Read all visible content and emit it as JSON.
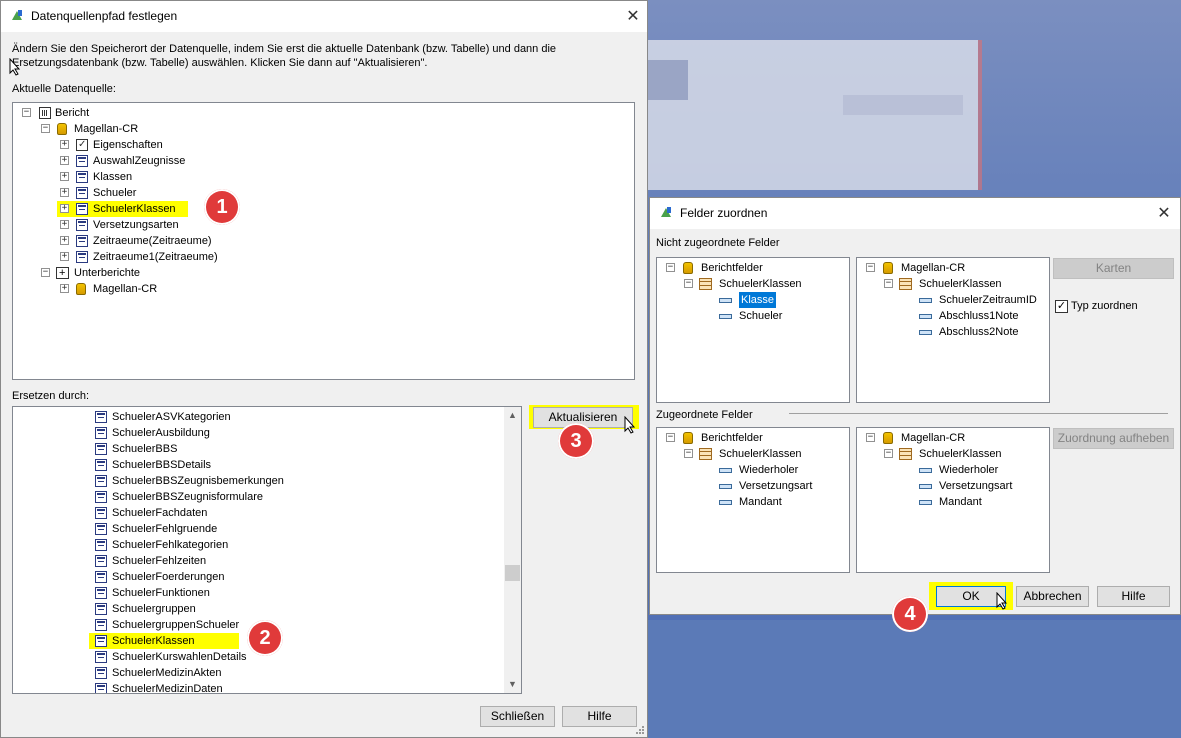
{
  "main_dialog": {
    "title": "Datenquellenpfad festlegen",
    "instruction_line1": "Ändern Sie den Speicherort der Datenquelle, indem Sie erst die aktuelle Datenbank (bzw. Tabelle) und dann die",
    "instruction_line2": "Ersetzungsdatenbank (bzw. Tabelle) auswählen. Klicken Sie dann auf \"Aktualisieren\".",
    "current_label": "Aktuelle Datenquelle:",
    "replace_label": "Ersetzen durch:",
    "update_button": "Aktualisieren",
    "close_button": "Schließen",
    "help_button": "Hilfe",
    "current_tree": {
      "root": "Bericht",
      "db": "Magellan-CR",
      "tables": [
        "Eigenschaften",
        "AuswahlZeugnisse",
        "Klassen",
        "Schueler",
        "SchuelerKlassen",
        "Versetzungsarten",
        "Zeitraeume(Zeitraeume)",
        "Zeitraeume1(Zeitraeume)"
      ],
      "subreports": "Unterberichte",
      "sub_db": "Magellan-CR"
    },
    "replace_list": [
      "SchuelerASVKategorien",
      "SchuelerAusbildung",
      "SchuelerBBS",
      "SchuelerBBSDetails",
      "SchuelerBBSZeugnisbemerkungen",
      "SchuelerBBSZeugnisformulare",
      "SchuelerFachdaten",
      "SchuelerFehlgruende",
      "SchuelerFehlkategorien",
      "SchuelerFehlzeiten",
      "SchuelerFoerderungen",
      "SchuelerFunktionen",
      "Schuelergruppen",
      "SchuelergruppenSchueler",
      "SchuelerKlassen",
      "SchuelerKurswahlenDetails",
      "SchuelerMedizinAkten",
      "SchuelerMedizinDaten"
    ]
  },
  "map_dialog": {
    "title": "Felder zuordnen",
    "unmapped_label": "Nicht zugeordnete Felder",
    "mapped_label": "Zugeordnete Felder",
    "maps_button": "Karten",
    "type_match_label": "Typ zuordnen",
    "unmap_button": "Zuordnung aufheben",
    "ok_button": "OK",
    "cancel_button": "Abbrechen",
    "help_button": "Hilfe",
    "report_fields": "Berichtfelder",
    "table": "SchuelerKlassen",
    "db": "Magellan-CR",
    "unmapped_report": [
      "Klasse",
      "Schueler"
    ],
    "unmapped_db": [
      "SchuelerZeitraumID",
      "Abschluss1Note",
      "Abschluss2Note"
    ],
    "mapped_report": [
      "Wiederholer",
      "Versetzungsart",
      "Mandant"
    ],
    "mapped_db": [
      "Wiederholer",
      "Versetzungsart",
      "Mandant"
    ]
  },
  "badges": [
    "1",
    "2",
    "3",
    "4"
  ],
  "colors": {
    "highlight": "#ffff00",
    "badge": "#e03a3a",
    "selection": "#0078d7"
  }
}
